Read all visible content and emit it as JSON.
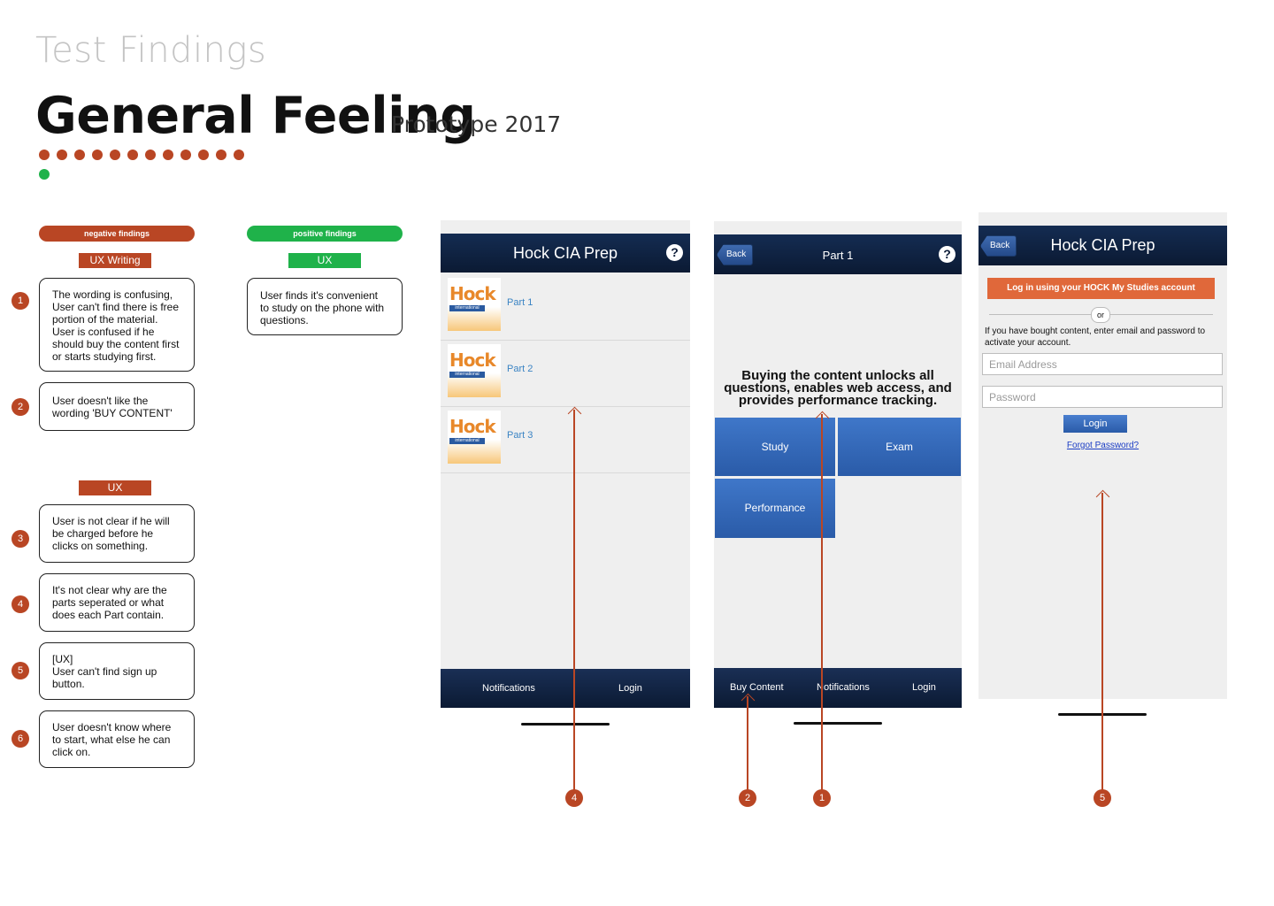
{
  "header": {
    "subtitle": "Test Findings",
    "title": "General Feeling",
    "prototype": "Prototype 2017"
  },
  "legend": {
    "negative": "negative findings",
    "positive": "positive findings"
  },
  "negative": {
    "ux_writing_tag": "UX Writing",
    "ux_tag": "UX",
    "findings": [
      {
        "num": "1",
        "text": "The wording is confusing,\nUser can't find there is free\nportion of the material.\nUser is confused if he\nshould buy the content first\nor starts studying first."
      },
      {
        "num": "2",
        "text": "User doesn't like the\nwording 'BUY CONTENT'"
      },
      {
        "num": "3",
        "text": "User is not clear if he will\nbe charged before he\nclicks on something."
      },
      {
        "num": "4",
        "text": "It's not clear why are the\nparts seperated or what\ndoes each Part contain."
      },
      {
        "num": "5",
        "text": "[UX]\nUser can't find sign up\nbutton."
      },
      {
        "num": "6",
        "text": "User doesn't know where\nto start, what else he can\nclick on."
      }
    ]
  },
  "positive": {
    "ux_tag": "UX",
    "findings": [
      {
        "text": "User finds it's convenient\nto study on the phone with\nquestions."
      }
    ]
  },
  "screen1": {
    "title": "Hock CIA Prep",
    "help": "?",
    "logo_text": "Hock",
    "logo_sub": "international",
    "parts": [
      "Part 1",
      "Part 2",
      "Part 3"
    ],
    "tabs": [
      "Notifications",
      "Login"
    ]
  },
  "screen2": {
    "back": "Back",
    "title": "Part 1",
    "help": "?",
    "message": "Buying the content unlocks all questions, enables web access, and provides performance tracking.",
    "tiles": [
      "Study",
      "Exam",
      "Performance"
    ],
    "tabs": [
      "Buy Content",
      "Notifications",
      "Login"
    ]
  },
  "screen3": {
    "back": "Back",
    "title": "Hock CIA Prep",
    "login_account": "Log in using your HOCK My Studies account",
    "or": "or",
    "info": "If you have bought content, enter email and password to activate your account.",
    "email_placeholder": "Email Address",
    "password_placeholder": "Password",
    "login": "Login",
    "forgot": "Forgot Password?"
  },
  "markers": [
    "4",
    "2",
    "1",
    "5"
  ],
  "colors": {
    "negative": "#b94624",
    "positive": "#1fb24a",
    "navbar": "#0d1c38",
    "tile": "#3468b8",
    "login_orange": "#e0683a"
  }
}
